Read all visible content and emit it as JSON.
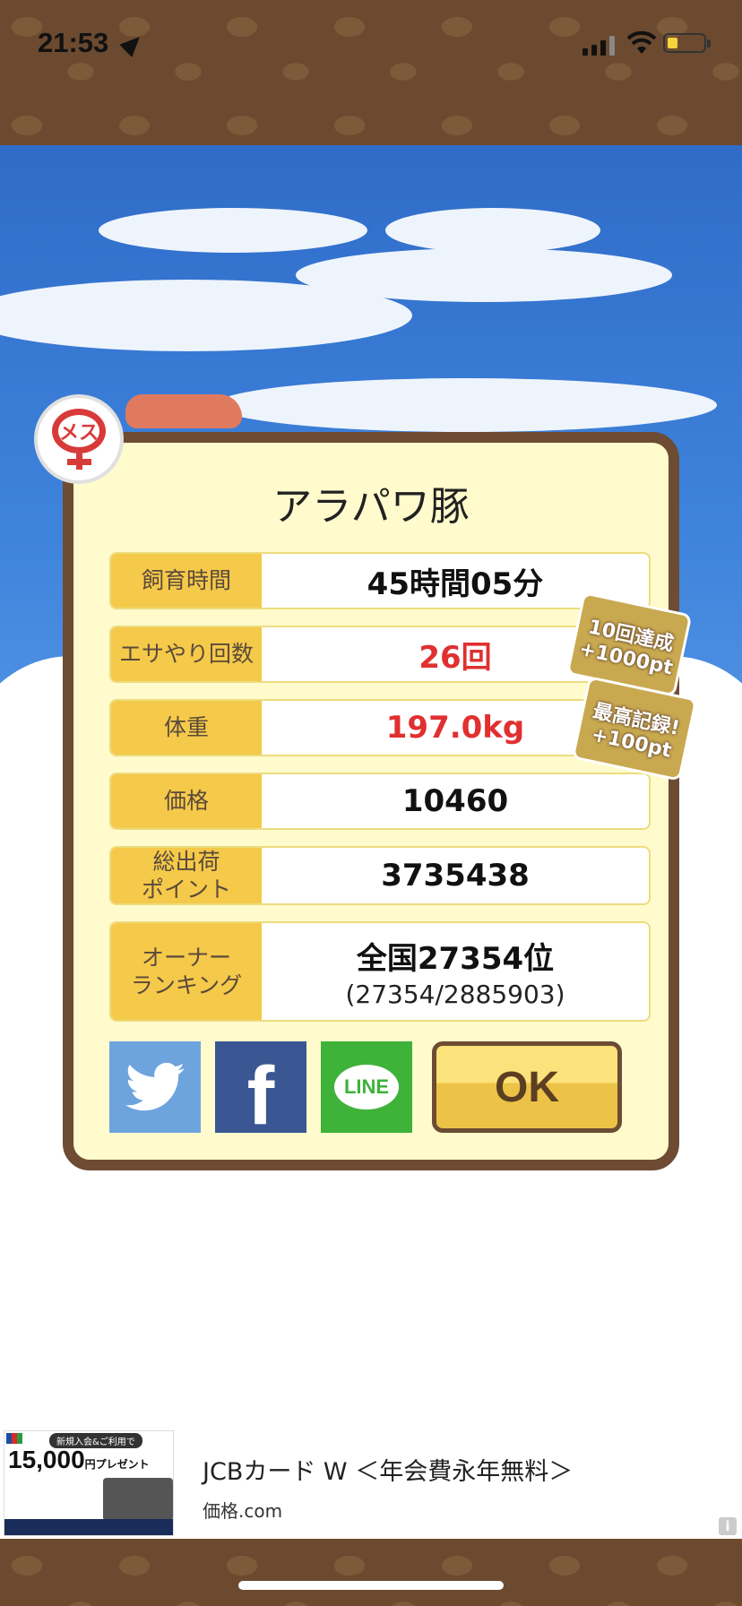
{
  "status_bar": {
    "time": "21:53"
  },
  "gender_badge": {
    "text": "メス"
  },
  "result": {
    "title": "アラパワ豚",
    "rows": [
      {
        "label": "飼育時間",
        "value": "45時間05分"
      },
      {
        "label": "エサやり回数",
        "value": "26回"
      },
      {
        "label": "体重",
        "value": "197.0kg"
      },
      {
        "label": "価格",
        "value": "10460"
      },
      {
        "label": "総出荷\nポイント",
        "value": "3735438"
      },
      {
        "label": "オーナー\nランキング",
        "value": "全国27354位",
        "sub": "(27354/2885903)"
      }
    ],
    "seals": [
      {
        "line1": "10回達成",
        "line2": "+1000pt"
      },
      {
        "line1": "最高記録!",
        "line2": "+100pt"
      }
    ],
    "share": {
      "line_label": "LINE",
      "facebook_letter": "f"
    },
    "ok_label": "OK"
  },
  "ad": {
    "banner_tag": "新規入会&ご利用で",
    "banner_amount": "15,000",
    "banner_unit": "円",
    "banner_suffix": "プレゼント",
    "title": "JCBカード W ＜年会費永年無料＞",
    "source": "価格.com",
    "info_icon": "i"
  },
  "colors": {
    "panel_border": "#6d4c33",
    "label_bg": "#f5c94a",
    "highlight_red": "#e03030"
  }
}
